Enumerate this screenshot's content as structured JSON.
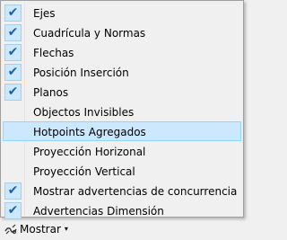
{
  "menu": {
    "items": [
      {
        "label": "Ejes",
        "checked": true
      },
      {
        "label": "Cuadrícula y Normas",
        "checked": true
      },
      {
        "label": "Flechas",
        "checked": true
      },
      {
        "label": "Posición Inserción",
        "checked": true
      },
      {
        "label": "Planos",
        "checked": true
      },
      {
        "label": "Objectos Invisibles",
        "checked": false
      },
      {
        "label": "Hotpoints Agregados",
        "checked": false,
        "highlighted": true
      },
      {
        "label": "Proyección Horizonal",
        "checked": false
      },
      {
        "label": "Proyección Vertical",
        "checked": false
      },
      {
        "label": "Mostrar advertencias de concurrencia",
        "checked": true
      },
      {
        "label": "Advertencias Dimensión",
        "checked": true
      }
    ],
    "check_glyph": "✔"
  },
  "toolbar": {
    "show_button_label": "Mostrar",
    "show_button_icon": "show-options-icon",
    "dropdown_arrow": "▾"
  },
  "colors": {
    "highlight_bg": "#cce8ff",
    "highlight_border": "#99d1ff",
    "check_color": "#1b5fad"
  }
}
